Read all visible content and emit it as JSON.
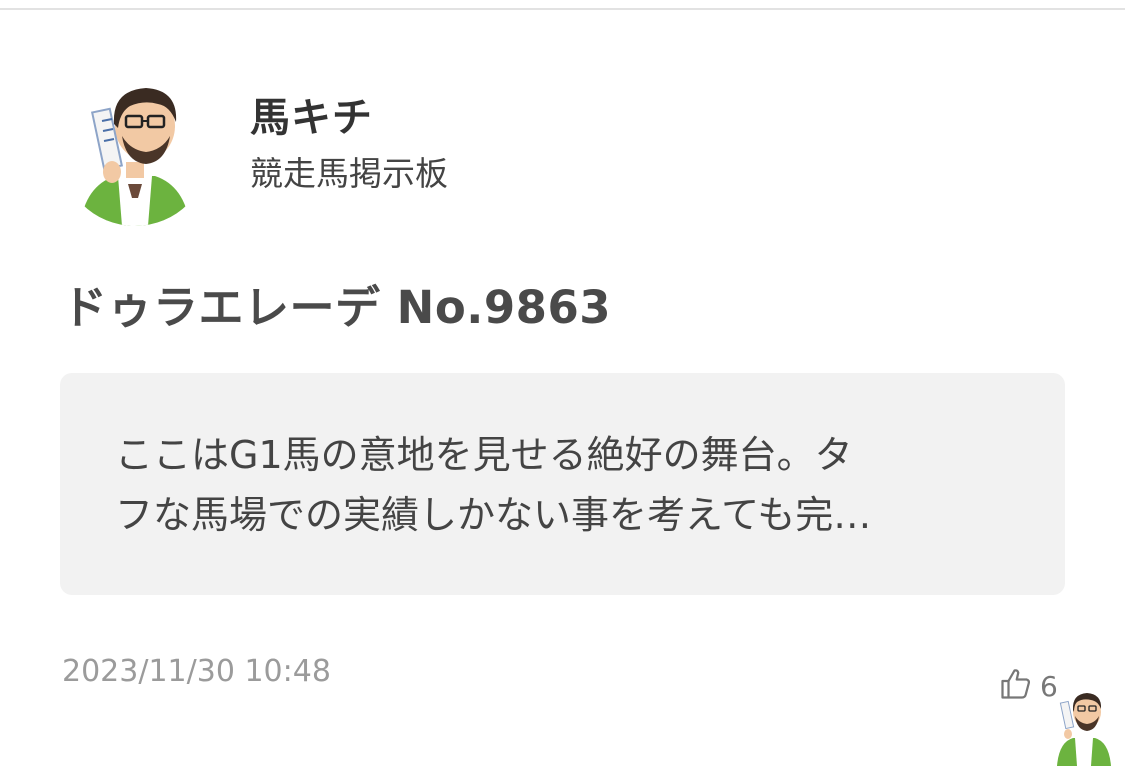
{
  "user": {
    "name": "馬キチ",
    "board": "競走馬掲示板"
  },
  "thread": {
    "title": "ドゥラエレーデ No.9863"
  },
  "post": {
    "lines": [
      "ここはG1馬の意地を見せる絶好の舞台。タ",
      "フな馬場での実績しかない事を考えても完…"
    ],
    "date": "2023/11/30 10:48",
    "like_count": "6"
  },
  "icons": {
    "like": "thumbs-up-icon",
    "avatar": "avatar-illustration"
  },
  "colors": {
    "post_background": "#f2f2f2",
    "shirt_green": "#6cb33f"
  }
}
